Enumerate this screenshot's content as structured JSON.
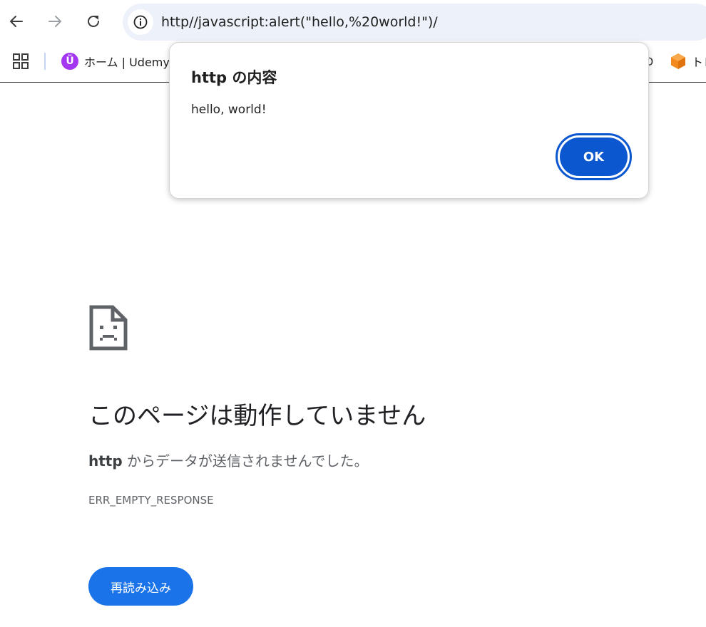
{
  "toolbar": {
    "back_icon": "arrow-left-icon",
    "forward_icon": "arrow-right-icon",
    "reload_icon": "reload-icon",
    "site_info_icon": "info-icon",
    "url": "http//javascript:alert(\"hello,%20world!\")/"
  },
  "bookmarks": {
    "apps_icon": "apps-grid-icon",
    "items": [
      {
        "label": "ホーム | Udemy",
        "icon": "udemy-logo-icon"
      },
      {
        "label": "トレ",
        "icon": "orange-cube-icon"
      }
    ],
    "partial_label_fragment": "D"
  },
  "dialog": {
    "title": "http の内容",
    "message": "hello, world!",
    "ok_label": "OK"
  },
  "error_page": {
    "icon": "sad-page-icon",
    "title": "このページは動作していません",
    "desc_host": "http",
    "desc_rest": " からデータが送信されませんでした。",
    "error_code": "ERR_EMPTY_RESPONSE",
    "reload_label": "再読み込み"
  },
  "colors": {
    "accent": "#1a73e8",
    "dialog_button": "#0b57d0",
    "omnibox_bg": "#edf2fa",
    "udemy": "#a435f0"
  }
}
